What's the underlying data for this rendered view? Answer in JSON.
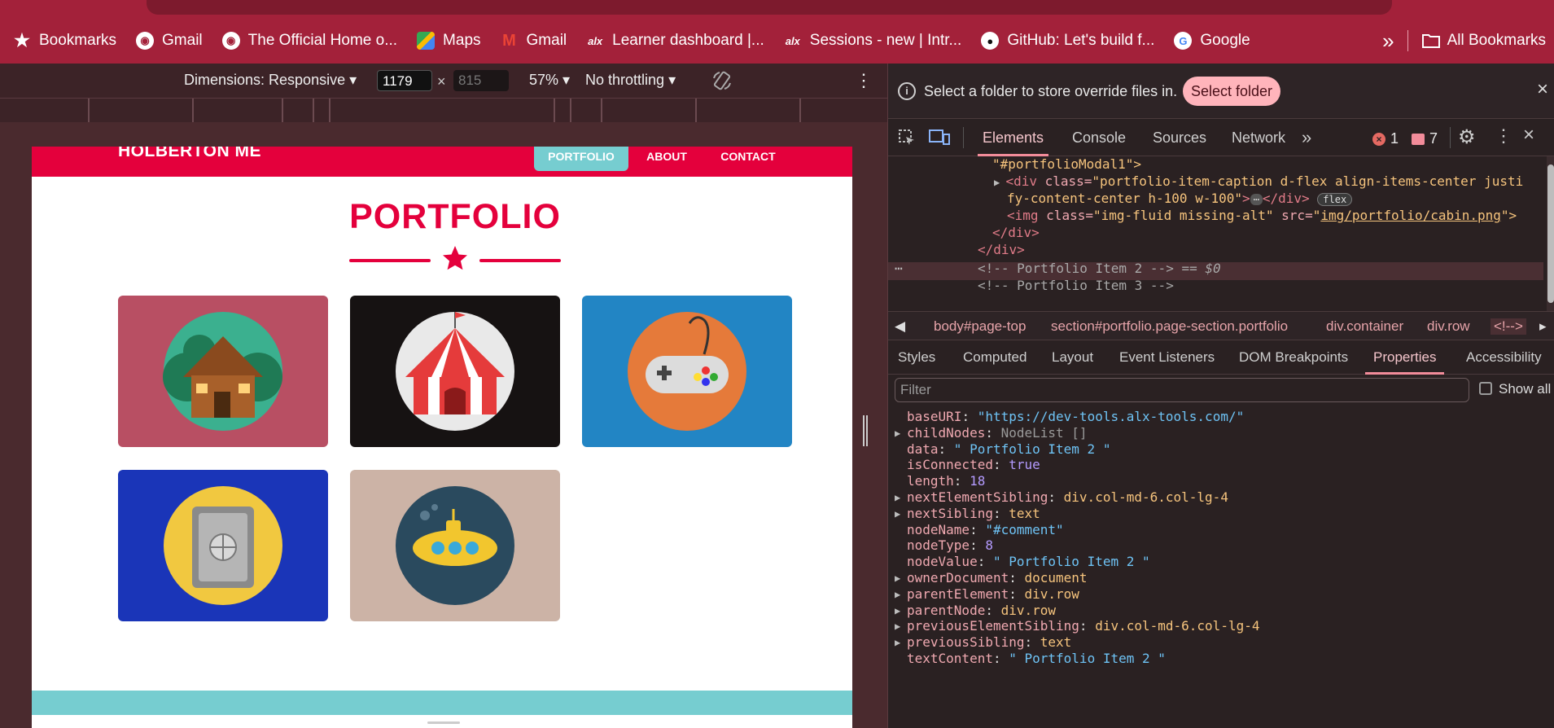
{
  "bookmarks_bar": {
    "items": [
      {
        "icon": "star-icon",
        "label": "Bookmarks"
      },
      {
        "icon": "globe-icon",
        "label": "Gmail"
      },
      {
        "icon": "globe-icon",
        "label": "The Official Home o..."
      },
      {
        "icon": "google-maps-icon",
        "label": "Maps"
      },
      {
        "icon": "gmail-icon",
        "label": "Gmail"
      },
      {
        "icon": "alx-icon",
        "label": "Learner dashboard |..."
      },
      {
        "icon": "alx-icon",
        "label": "Sessions - new | Intr..."
      },
      {
        "icon": "github-icon",
        "label": "GitHub: Let's build f..."
      },
      {
        "icon": "google-icon",
        "label": "Google"
      }
    ],
    "overflow_glyph": "»",
    "all_bookmarks": "All Bookmarks"
  },
  "device_toolbar": {
    "dimensions": "Dimensions: Responsive",
    "width": "1179",
    "times": "×",
    "height": "815",
    "zoom": "57%",
    "throttling": "No throttling",
    "more": "⋮"
  },
  "emulated_page": {
    "brand": "HOLBERTON ME",
    "nav": [
      "PORTFOLIO",
      "ABOUT",
      "CONTACT"
    ],
    "section_title": "PORTFOLIO",
    "tiles": [
      {
        "name": "cabin",
        "bg": "#b84f63"
      },
      {
        "name": "circus",
        "bg": "#161212"
      },
      {
        "name": "game",
        "bg": "#2285c4"
      },
      {
        "name": "safe",
        "bg": "#1a35b8"
      },
      {
        "name": "submarine",
        "bg": "#ccb3a6"
      }
    ]
  },
  "devtools": {
    "notice": {
      "text": "Select a folder to store override files in.",
      "button": "Select folder",
      "close": "×"
    },
    "tabs": [
      "Elements",
      "Console",
      "Sources",
      "Network"
    ],
    "tabs_more": "»",
    "error_count": "1",
    "message_count": "7",
    "code_lines": [
      {
        "text": "\"#portfolioModal1\">"
      },
      {
        "tag_open": "<div ",
        "attr": "class=",
        "value": "\"portfolio-item-caption d-flex align-items-center justi"
      },
      {
        "value": "fy-content-center h-100 w-100\"",
        "tag_close": "></div>",
        "badge": "flex"
      },
      {
        "tag_open": "<img ",
        "attr": "class=",
        "value": "\"img-fluid missing-alt\"",
        "attr2": " src=",
        "link": "img/portfolio/cabin.png",
        "end": "\">"
      },
      {
        "text": "</div>"
      },
      {
        "text": "</div>"
      },
      {
        "comment": "<!-- Portfolio Item 2 -->",
        "eq": " == $0"
      },
      {
        "comment": "<!-- Portfolio Item 3 -->"
      }
    ],
    "breadcrumbs": [
      "body#page-top",
      "section#portfolio.page-section.portfolio",
      "div.container",
      "div.row",
      "<!-->"
    ],
    "subtabs": [
      "Styles",
      "Computed",
      "Layout",
      "Event Listeners",
      "DOM Breakpoints",
      "Properties",
      "Accessibility"
    ],
    "filter_placeholder": "Filter",
    "show_all": "Show all",
    "properties": [
      {
        "key": "baseURI",
        "value": "\"https://dev-tools.alx-tools.com/\"",
        "kind": "str",
        "expandable": false
      },
      {
        "key": "childNodes",
        "value": "NodeList []",
        "kind": "gray",
        "expandable": true
      },
      {
        "key": "data",
        "value": "\" Portfolio Item 2 \"",
        "kind": "str",
        "expandable": false
      },
      {
        "key": "isConnected",
        "value": "true",
        "kind": "bool",
        "expandable": false
      },
      {
        "key": "length",
        "value": "18",
        "kind": "num",
        "expandable": false
      },
      {
        "key": "nextElementSibling",
        "value": "div.col-md-6.col-lg-4",
        "kind": "obj",
        "expandable": true
      },
      {
        "key": "nextSibling",
        "value": "text",
        "kind": "obj",
        "expandable": true
      },
      {
        "key": "nodeName",
        "value": "\"#comment\"",
        "kind": "str",
        "expandable": false
      },
      {
        "key": "nodeType",
        "value": "8",
        "kind": "num",
        "expandable": false
      },
      {
        "key": "nodeValue",
        "value": "\" Portfolio Item 2 \"",
        "kind": "str",
        "expandable": false
      },
      {
        "key": "ownerDocument",
        "value": "document",
        "kind": "obj",
        "expandable": true
      },
      {
        "key": "parentElement",
        "value": "div.row",
        "kind": "obj",
        "expandable": true
      },
      {
        "key": "parentNode",
        "value": "div.row",
        "kind": "obj",
        "expandable": true
      },
      {
        "key": "previousElementSibling",
        "value": "div.col-md-6.col-lg-4",
        "kind": "obj",
        "expandable": true
      },
      {
        "key": "previousSibling",
        "value": "text",
        "kind": "obj",
        "expandable": true
      },
      {
        "key": "textContent",
        "value": "\" Portfolio Item 2 \"",
        "kind": "str",
        "expandable": false
      }
    ]
  },
  "colors": {
    "chrome_accent": "#a3213a",
    "page_primary": "#e4003c",
    "page_secondary": "#76cdd0"
  }
}
